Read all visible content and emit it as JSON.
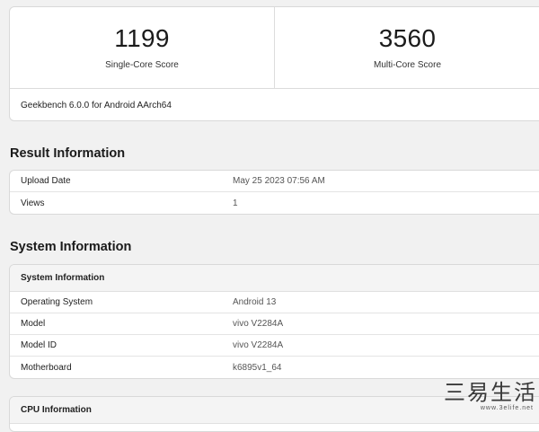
{
  "scores": {
    "single_core_value": "1199",
    "single_core_label": "Single-Core Score",
    "multi_core_value": "3560",
    "multi_core_label": "Multi-Core Score",
    "version": "Geekbench 6.0.0 for Android AArch64"
  },
  "result_info": {
    "title": "Result Information",
    "rows": [
      {
        "key": "Upload Date",
        "value": "May 25 2023 07:56 AM"
      },
      {
        "key": "Views",
        "value": "1"
      }
    ]
  },
  "system_info": {
    "title": "System Information",
    "header": "System Information",
    "rows": [
      {
        "key": "Operating System",
        "value": "Android 13"
      },
      {
        "key": "Model",
        "value": "vivo V2284A"
      },
      {
        "key": "Model ID",
        "value": "vivo V2284A"
      },
      {
        "key": "Motherboard",
        "value": "k6895v1_64"
      }
    ]
  },
  "cpu_info": {
    "header": "CPU Information"
  },
  "watermark": {
    "text": "三易生活",
    "url": "www.3elife.net"
  }
}
